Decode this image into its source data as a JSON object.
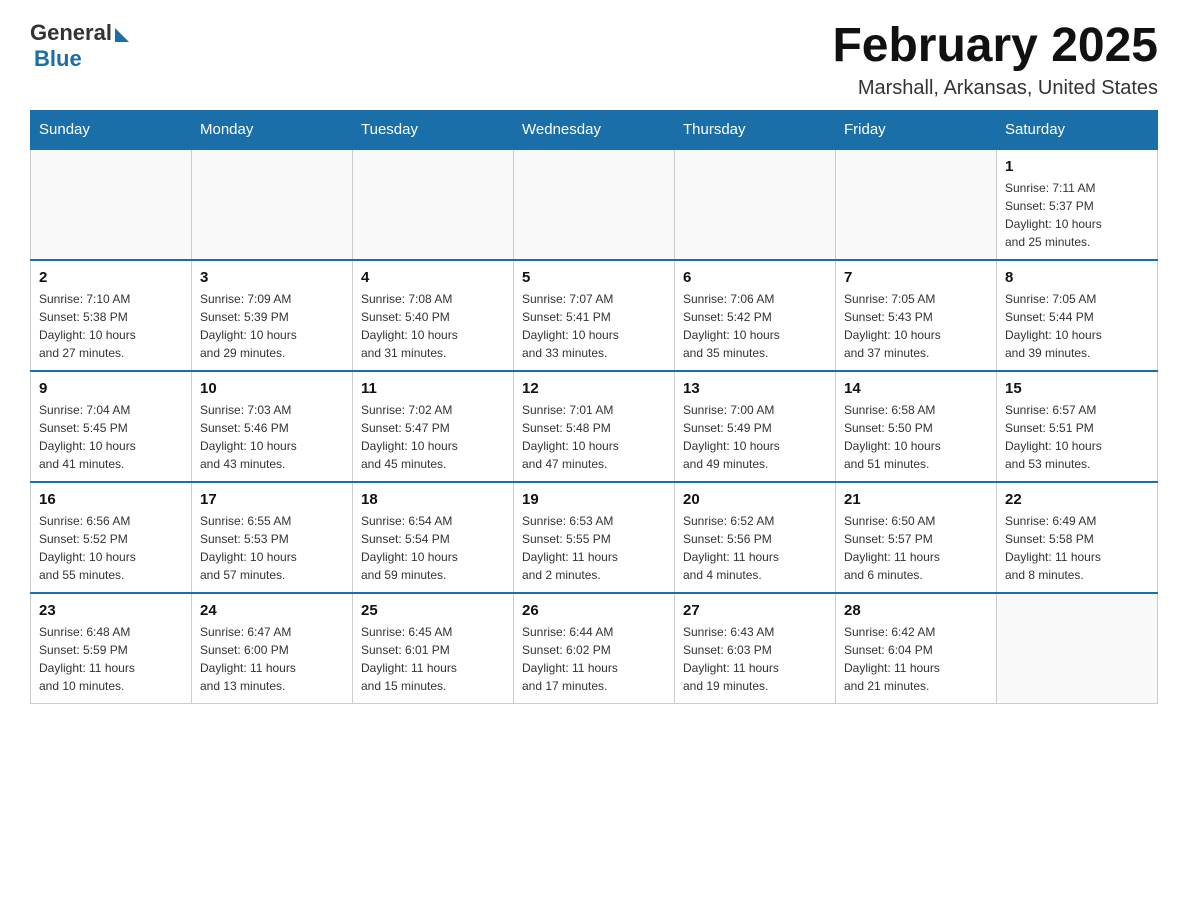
{
  "logo": {
    "general": "General",
    "blue": "Blue"
  },
  "title": "February 2025",
  "location": "Marshall, Arkansas, United States",
  "days_of_week": [
    "Sunday",
    "Monday",
    "Tuesday",
    "Wednesday",
    "Thursday",
    "Friday",
    "Saturday"
  ],
  "weeks": [
    [
      {
        "day": "",
        "info": ""
      },
      {
        "day": "",
        "info": ""
      },
      {
        "day": "",
        "info": ""
      },
      {
        "day": "",
        "info": ""
      },
      {
        "day": "",
        "info": ""
      },
      {
        "day": "",
        "info": ""
      },
      {
        "day": "1",
        "info": "Sunrise: 7:11 AM\nSunset: 5:37 PM\nDaylight: 10 hours\nand 25 minutes."
      }
    ],
    [
      {
        "day": "2",
        "info": "Sunrise: 7:10 AM\nSunset: 5:38 PM\nDaylight: 10 hours\nand 27 minutes."
      },
      {
        "day": "3",
        "info": "Sunrise: 7:09 AM\nSunset: 5:39 PM\nDaylight: 10 hours\nand 29 minutes."
      },
      {
        "day": "4",
        "info": "Sunrise: 7:08 AM\nSunset: 5:40 PM\nDaylight: 10 hours\nand 31 minutes."
      },
      {
        "day": "5",
        "info": "Sunrise: 7:07 AM\nSunset: 5:41 PM\nDaylight: 10 hours\nand 33 minutes."
      },
      {
        "day": "6",
        "info": "Sunrise: 7:06 AM\nSunset: 5:42 PM\nDaylight: 10 hours\nand 35 minutes."
      },
      {
        "day": "7",
        "info": "Sunrise: 7:05 AM\nSunset: 5:43 PM\nDaylight: 10 hours\nand 37 minutes."
      },
      {
        "day": "8",
        "info": "Sunrise: 7:05 AM\nSunset: 5:44 PM\nDaylight: 10 hours\nand 39 minutes."
      }
    ],
    [
      {
        "day": "9",
        "info": "Sunrise: 7:04 AM\nSunset: 5:45 PM\nDaylight: 10 hours\nand 41 minutes."
      },
      {
        "day": "10",
        "info": "Sunrise: 7:03 AM\nSunset: 5:46 PM\nDaylight: 10 hours\nand 43 minutes."
      },
      {
        "day": "11",
        "info": "Sunrise: 7:02 AM\nSunset: 5:47 PM\nDaylight: 10 hours\nand 45 minutes."
      },
      {
        "day": "12",
        "info": "Sunrise: 7:01 AM\nSunset: 5:48 PM\nDaylight: 10 hours\nand 47 minutes."
      },
      {
        "day": "13",
        "info": "Sunrise: 7:00 AM\nSunset: 5:49 PM\nDaylight: 10 hours\nand 49 minutes."
      },
      {
        "day": "14",
        "info": "Sunrise: 6:58 AM\nSunset: 5:50 PM\nDaylight: 10 hours\nand 51 minutes."
      },
      {
        "day": "15",
        "info": "Sunrise: 6:57 AM\nSunset: 5:51 PM\nDaylight: 10 hours\nand 53 minutes."
      }
    ],
    [
      {
        "day": "16",
        "info": "Sunrise: 6:56 AM\nSunset: 5:52 PM\nDaylight: 10 hours\nand 55 minutes."
      },
      {
        "day": "17",
        "info": "Sunrise: 6:55 AM\nSunset: 5:53 PM\nDaylight: 10 hours\nand 57 minutes."
      },
      {
        "day": "18",
        "info": "Sunrise: 6:54 AM\nSunset: 5:54 PM\nDaylight: 10 hours\nand 59 minutes."
      },
      {
        "day": "19",
        "info": "Sunrise: 6:53 AM\nSunset: 5:55 PM\nDaylight: 11 hours\nand 2 minutes."
      },
      {
        "day": "20",
        "info": "Sunrise: 6:52 AM\nSunset: 5:56 PM\nDaylight: 11 hours\nand 4 minutes."
      },
      {
        "day": "21",
        "info": "Sunrise: 6:50 AM\nSunset: 5:57 PM\nDaylight: 11 hours\nand 6 minutes."
      },
      {
        "day": "22",
        "info": "Sunrise: 6:49 AM\nSunset: 5:58 PM\nDaylight: 11 hours\nand 8 minutes."
      }
    ],
    [
      {
        "day": "23",
        "info": "Sunrise: 6:48 AM\nSunset: 5:59 PM\nDaylight: 11 hours\nand 10 minutes."
      },
      {
        "day": "24",
        "info": "Sunrise: 6:47 AM\nSunset: 6:00 PM\nDaylight: 11 hours\nand 13 minutes."
      },
      {
        "day": "25",
        "info": "Sunrise: 6:45 AM\nSunset: 6:01 PM\nDaylight: 11 hours\nand 15 minutes."
      },
      {
        "day": "26",
        "info": "Sunrise: 6:44 AM\nSunset: 6:02 PM\nDaylight: 11 hours\nand 17 minutes."
      },
      {
        "day": "27",
        "info": "Sunrise: 6:43 AM\nSunset: 6:03 PM\nDaylight: 11 hours\nand 19 minutes."
      },
      {
        "day": "28",
        "info": "Sunrise: 6:42 AM\nSunset: 6:04 PM\nDaylight: 11 hours\nand 21 minutes."
      },
      {
        "day": "",
        "info": ""
      }
    ]
  ]
}
